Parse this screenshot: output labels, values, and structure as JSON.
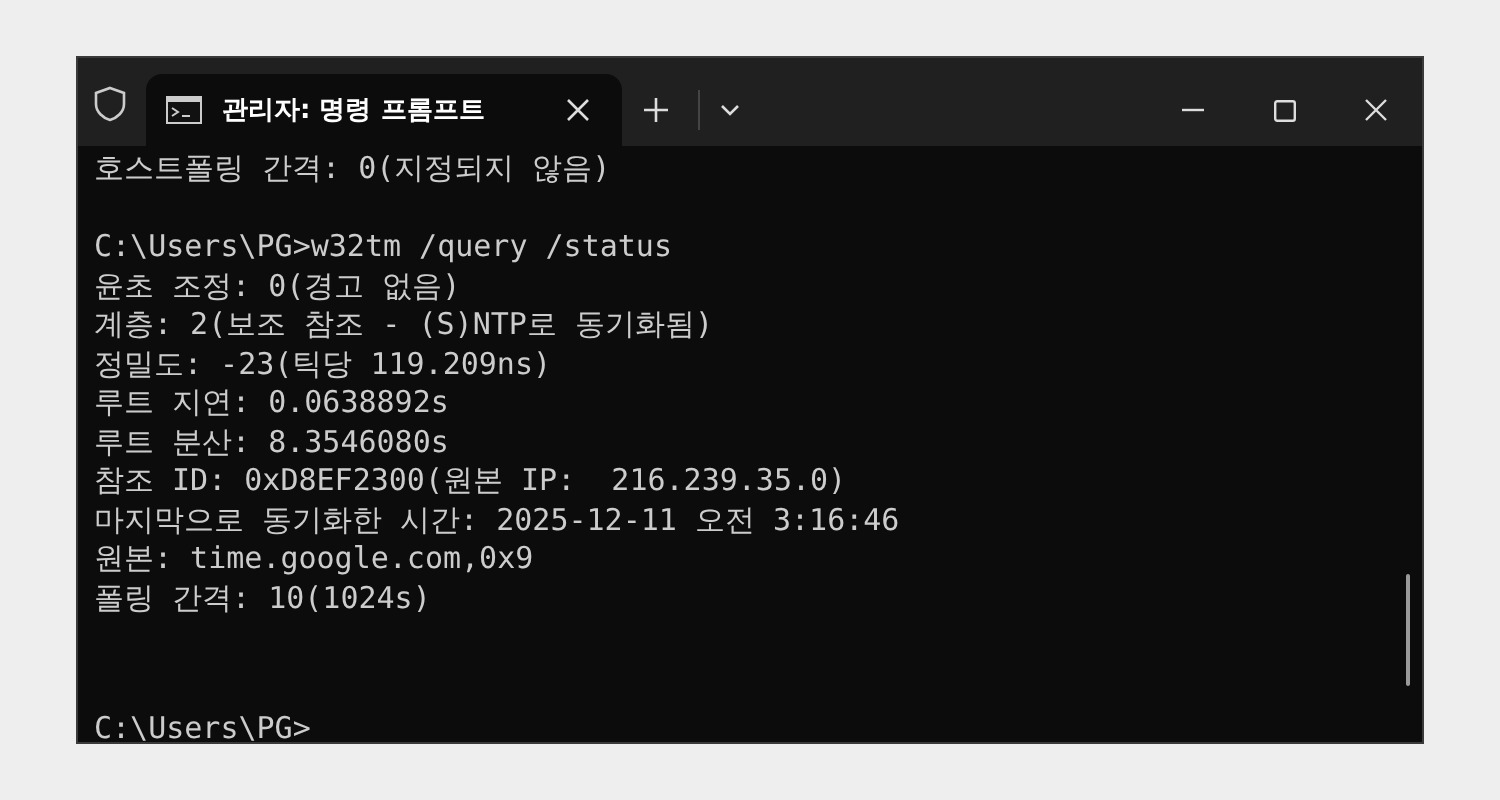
{
  "window": {
    "tab": {
      "title": "관리자: 명령 프롬프트",
      "selected": true
    }
  },
  "terminal": {
    "blocks": [
      {
        "kind": "output",
        "lines": [
          "호스트폴링 간격: 0(지정되지 않음)"
        ]
      },
      {
        "kind": "output",
        "lines": [
          "C:\\Users\\PG>w32tm /query /status",
          "윤초 조정: 0(경고 없음)",
          "계층: 2(보조 참조 - (S)NTP로 동기화됨)",
          "정밀도: -23(틱당 119.209ns)",
          "루트 지연: 0.0638892s",
          "루트 분산: 8.3546080s",
          "참조 ID: 0xD8EF2300(원본 IP:  216.239.35.0)",
          "마지막으로 동기화한 시간: 2025-12-11 오전 3:16:46",
          "원본: time.google.com,0x9",
          "폴링 간격: 10(1024s)"
        ]
      },
      {
        "kind": "prompt",
        "lines": [
          "C:\\Users\\PG>"
        ]
      }
    ]
  }
}
